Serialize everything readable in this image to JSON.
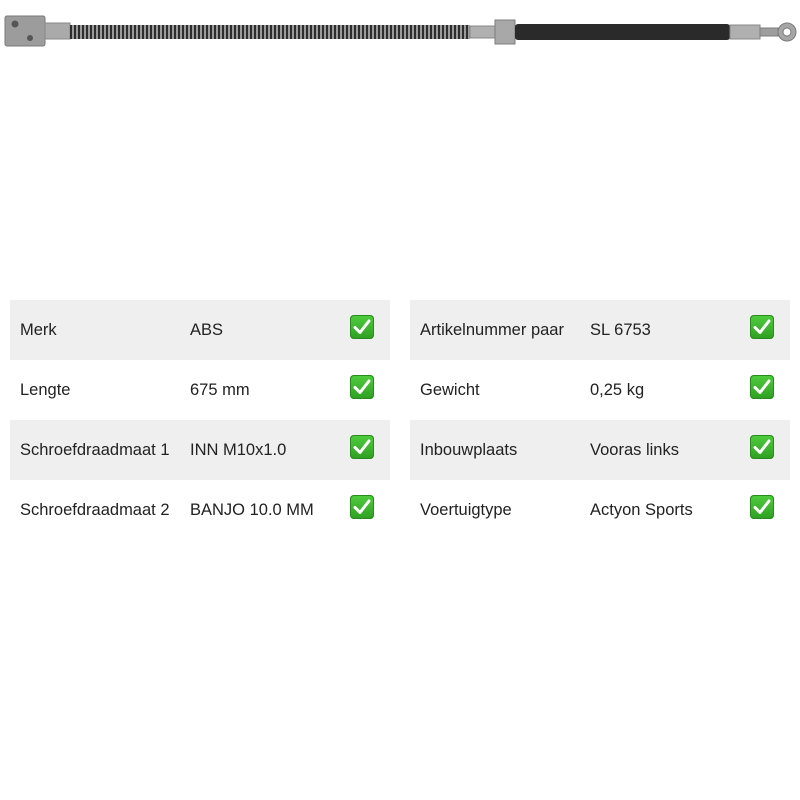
{
  "product": {
    "image_icon": "brake-hose-image",
    "colors": {
      "metal": "#9a9a9a",
      "hose": "#2b2b2b",
      "check": "#3bb42c"
    }
  },
  "specs_left": [
    {
      "label": "Merk",
      "value": "ABS",
      "check_icon": "check-mark-icon"
    },
    {
      "label": "Lengte",
      "value": "675 mm",
      "check_icon": "check-mark-icon"
    },
    {
      "label": "Schroefdraadmaat 1",
      "value": "INN M10x1.0",
      "check_icon": "check-mark-icon"
    },
    {
      "label": "Schroefdraadmaat 2",
      "value": "BANJO 10.0 MM",
      "check_icon": "check-mark-icon"
    }
  ],
  "specs_right": [
    {
      "label": "Artikelnummer paar",
      "value": "SL 6753",
      "check_icon": "check-mark-icon"
    },
    {
      "label": "Gewicht",
      "value": "0,25 kg",
      "check_icon": "check-mark-icon"
    },
    {
      "label": "Inbouwplaats",
      "value": "Vooras links",
      "check_icon": "check-mark-icon"
    },
    {
      "label": "Voertuigtype",
      "value": "Actyon Sports",
      "check_icon": "check-mark-icon"
    }
  ]
}
